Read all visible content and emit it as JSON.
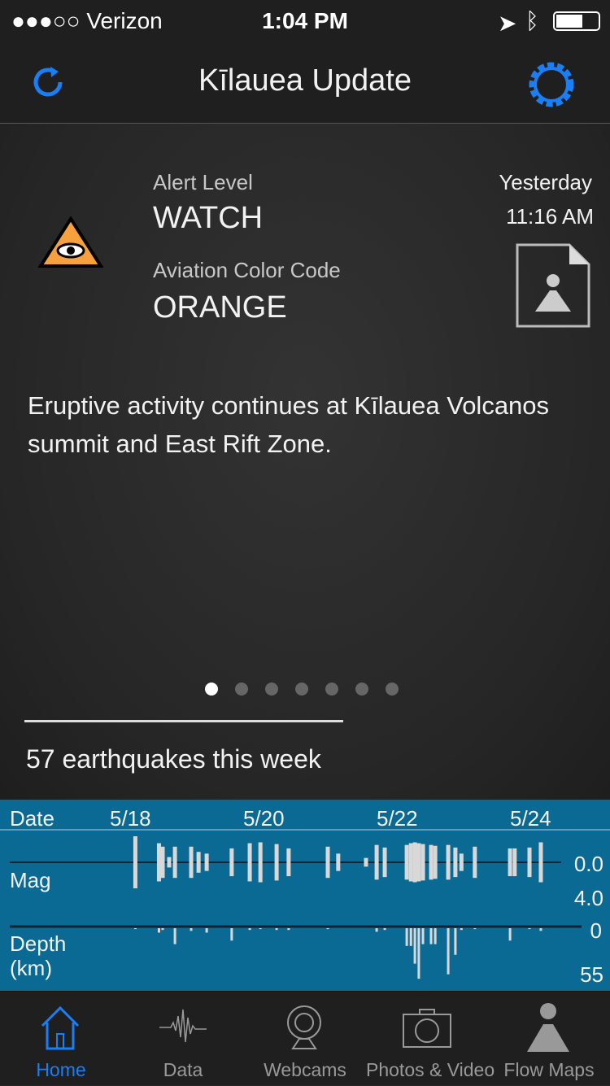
{
  "status_bar": {
    "carrier": "●●●○○ Verizon",
    "time": "1:04 PM"
  },
  "nav": {
    "title": "Kīlauea Update",
    "refresh_icon": "refresh-icon",
    "settings_icon": "gear-icon",
    "accent": "#1a7ef5"
  },
  "alert": {
    "alert_level_label": "Alert Level",
    "alert_level": "WATCH",
    "aviation_label": "Aviation Color Code",
    "aviation_code": "ORANGE",
    "date": "Yesterday",
    "time": "11:16 AM",
    "alert_icon": "eye-triangle-icon",
    "alert_color": "#f7a13e",
    "document_icon": "volcano-document-icon"
  },
  "description": "Eruptive activity continues at Kīlauea Volcanos summit and East Rift Zone.",
  "pager": {
    "count": 7,
    "active": 0
  },
  "quake_summary": "57 earthquakes this week",
  "chart_data": {
    "type": "bar",
    "date_label": "Date",
    "mag_label": "Mag",
    "depth_label": "Depth",
    "depth_unit": "(km)",
    "date_ticks": [
      "5/18",
      "5/20",
      "5/22",
      "5/24"
    ],
    "mag_axis": [
      "0.0",
      "4.0"
    ],
    "mag_range": [
      0,
      4
    ],
    "depth_axis": [
      "0",
      "55"
    ],
    "depth_range": [
      0,
      55
    ],
    "background": "#0b6a94",
    "bar_color": "#d8d8d8",
    "events": [
      {
        "time": "5/18 01:00",
        "mag": 3.0,
        "depth": 1
      },
      {
        "time": "5/18 09:30",
        "mag": 2.2,
        "depth": 5
      },
      {
        "time": "5/18 10:50",
        "mag": 1.8,
        "depth": 2
      },
      {
        "time": "5/18 13:10",
        "mag": 0.6,
        "depth": 0
      },
      {
        "time": "5/18 15:15",
        "mag": 1.8,
        "depth": 18
      },
      {
        "time": "5/18 21:05",
        "mag": 1.8,
        "depth": 3
      },
      {
        "time": "5/18 23:45",
        "mag": 1.2,
        "depth": 0
      },
      {
        "time": "5/19 02:40",
        "mag": 1.0,
        "depth": 5
      },
      {
        "time": "5/19 11:40",
        "mag": 1.6,
        "depth": 14
      },
      {
        "time": "5/19 18:10",
        "mag": 2.2,
        "depth": 2
      },
      {
        "time": "5/19 22:00",
        "mag": 2.3,
        "depth": 1
      },
      {
        "time": "5/20 03:50",
        "mag": 2.1,
        "depth": 2
      },
      {
        "time": "5/20 08:10",
        "mag": 1.6,
        "depth": 2
      },
      {
        "time": "5/20 22:15",
        "mag": 1.8,
        "depth": 1
      },
      {
        "time": "5/21 02:00",
        "mag": 1.0,
        "depth": 0
      },
      {
        "time": "5/21 12:00",
        "mag": 0.5,
        "depth": 0
      },
      {
        "time": "5/21 15:50",
        "mag": 2.0,
        "depth": 4
      },
      {
        "time": "5/21 18:45",
        "mag": 1.7,
        "depth": 2
      },
      {
        "time": "5/22 02:40",
        "mag": 2.0,
        "depth": 20
      },
      {
        "time": "5/22 04:10",
        "mag": 2.2,
        "depth": 20
      },
      {
        "time": "5/22 05:35",
        "mag": 2.3,
        "depth": 40
      },
      {
        "time": "5/22 07:00",
        "mag": 2.2,
        "depth": 57
      },
      {
        "time": "5/22 08:30",
        "mag": 2.1,
        "depth": 18
      },
      {
        "time": "5/22 11:25",
        "mag": 2.0,
        "depth": 18
      },
      {
        "time": "5/22 12:55",
        "mag": 1.9,
        "depth": 18
      },
      {
        "time": "5/22 17:35",
        "mag": 2.0,
        "depth": 52
      },
      {
        "time": "5/22 20:10",
        "mag": 1.7,
        "depth": 30
      },
      {
        "time": "5/22 22:20",
        "mag": 1.0,
        "depth": 2
      },
      {
        "time": "5/23 03:10",
        "mag": 1.8,
        "depth": 1
      },
      {
        "time": "5/23 15:50",
        "mag": 1.6,
        "depth": 14
      },
      {
        "time": "5/23 17:30",
        "mag": 1.6,
        "depth": 0
      },
      {
        "time": "5/23 22:50",
        "mag": 1.7,
        "depth": 1
      },
      {
        "time": "5/24 02:55",
        "mag": 2.3,
        "depth": 3
      }
    ]
  },
  "tabs": [
    {
      "label": "Home",
      "icon": "home-icon",
      "active": true
    },
    {
      "label": "Data",
      "icon": "seismogram-icon"
    },
    {
      "label": "Webcams",
      "icon": "webcam-icon"
    },
    {
      "label": "Photos & Video",
      "icon": "camera-icon"
    },
    {
      "label": "Flow Maps",
      "icon": "volcano-icon"
    }
  ]
}
